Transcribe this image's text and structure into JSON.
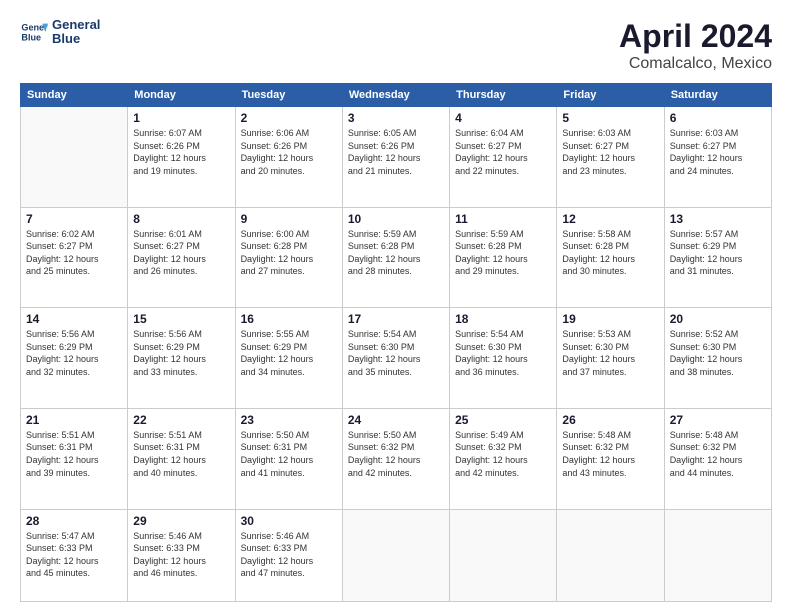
{
  "header": {
    "logo_line1": "General",
    "logo_line2": "Blue",
    "main_title": "April 2024",
    "subtitle": "Comalcalco, Mexico"
  },
  "days_of_week": [
    "Sunday",
    "Monday",
    "Tuesday",
    "Wednesday",
    "Thursday",
    "Friday",
    "Saturday"
  ],
  "weeks": [
    [
      {
        "num": "",
        "info": ""
      },
      {
        "num": "1",
        "info": "Sunrise: 6:07 AM\nSunset: 6:26 PM\nDaylight: 12 hours\nand 19 minutes."
      },
      {
        "num": "2",
        "info": "Sunrise: 6:06 AM\nSunset: 6:26 PM\nDaylight: 12 hours\nand 20 minutes."
      },
      {
        "num": "3",
        "info": "Sunrise: 6:05 AM\nSunset: 6:26 PM\nDaylight: 12 hours\nand 21 minutes."
      },
      {
        "num": "4",
        "info": "Sunrise: 6:04 AM\nSunset: 6:27 PM\nDaylight: 12 hours\nand 22 minutes."
      },
      {
        "num": "5",
        "info": "Sunrise: 6:03 AM\nSunset: 6:27 PM\nDaylight: 12 hours\nand 23 minutes."
      },
      {
        "num": "6",
        "info": "Sunrise: 6:03 AM\nSunset: 6:27 PM\nDaylight: 12 hours\nand 24 minutes."
      }
    ],
    [
      {
        "num": "7",
        "info": "Sunrise: 6:02 AM\nSunset: 6:27 PM\nDaylight: 12 hours\nand 25 minutes."
      },
      {
        "num": "8",
        "info": "Sunrise: 6:01 AM\nSunset: 6:27 PM\nDaylight: 12 hours\nand 26 minutes."
      },
      {
        "num": "9",
        "info": "Sunrise: 6:00 AM\nSunset: 6:28 PM\nDaylight: 12 hours\nand 27 minutes."
      },
      {
        "num": "10",
        "info": "Sunrise: 5:59 AM\nSunset: 6:28 PM\nDaylight: 12 hours\nand 28 minutes."
      },
      {
        "num": "11",
        "info": "Sunrise: 5:59 AM\nSunset: 6:28 PM\nDaylight: 12 hours\nand 29 minutes."
      },
      {
        "num": "12",
        "info": "Sunrise: 5:58 AM\nSunset: 6:28 PM\nDaylight: 12 hours\nand 30 minutes."
      },
      {
        "num": "13",
        "info": "Sunrise: 5:57 AM\nSunset: 6:29 PM\nDaylight: 12 hours\nand 31 minutes."
      }
    ],
    [
      {
        "num": "14",
        "info": "Sunrise: 5:56 AM\nSunset: 6:29 PM\nDaylight: 12 hours\nand 32 minutes."
      },
      {
        "num": "15",
        "info": "Sunrise: 5:56 AM\nSunset: 6:29 PM\nDaylight: 12 hours\nand 33 minutes."
      },
      {
        "num": "16",
        "info": "Sunrise: 5:55 AM\nSunset: 6:29 PM\nDaylight: 12 hours\nand 34 minutes."
      },
      {
        "num": "17",
        "info": "Sunrise: 5:54 AM\nSunset: 6:30 PM\nDaylight: 12 hours\nand 35 minutes."
      },
      {
        "num": "18",
        "info": "Sunrise: 5:54 AM\nSunset: 6:30 PM\nDaylight: 12 hours\nand 36 minutes."
      },
      {
        "num": "19",
        "info": "Sunrise: 5:53 AM\nSunset: 6:30 PM\nDaylight: 12 hours\nand 37 minutes."
      },
      {
        "num": "20",
        "info": "Sunrise: 5:52 AM\nSunset: 6:30 PM\nDaylight: 12 hours\nand 38 minutes."
      }
    ],
    [
      {
        "num": "21",
        "info": "Sunrise: 5:51 AM\nSunset: 6:31 PM\nDaylight: 12 hours\nand 39 minutes."
      },
      {
        "num": "22",
        "info": "Sunrise: 5:51 AM\nSunset: 6:31 PM\nDaylight: 12 hours\nand 40 minutes."
      },
      {
        "num": "23",
        "info": "Sunrise: 5:50 AM\nSunset: 6:31 PM\nDaylight: 12 hours\nand 41 minutes."
      },
      {
        "num": "24",
        "info": "Sunrise: 5:50 AM\nSunset: 6:32 PM\nDaylight: 12 hours\nand 42 minutes."
      },
      {
        "num": "25",
        "info": "Sunrise: 5:49 AM\nSunset: 6:32 PM\nDaylight: 12 hours\nand 42 minutes."
      },
      {
        "num": "26",
        "info": "Sunrise: 5:48 AM\nSunset: 6:32 PM\nDaylight: 12 hours\nand 43 minutes."
      },
      {
        "num": "27",
        "info": "Sunrise: 5:48 AM\nSunset: 6:32 PM\nDaylight: 12 hours\nand 44 minutes."
      }
    ],
    [
      {
        "num": "28",
        "info": "Sunrise: 5:47 AM\nSunset: 6:33 PM\nDaylight: 12 hours\nand 45 minutes."
      },
      {
        "num": "29",
        "info": "Sunrise: 5:46 AM\nSunset: 6:33 PM\nDaylight: 12 hours\nand 46 minutes."
      },
      {
        "num": "30",
        "info": "Sunrise: 5:46 AM\nSunset: 6:33 PM\nDaylight: 12 hours\nand 47 minutes."
      },
      {
        "num": "",
        "info": ""
      },
      {
        "num": "",
        "info": ""
      },
      {
        "num": "",
        "info": ""
      },
      {
        "num": "",
        "info": ""
      }
    ]
  ]
}
